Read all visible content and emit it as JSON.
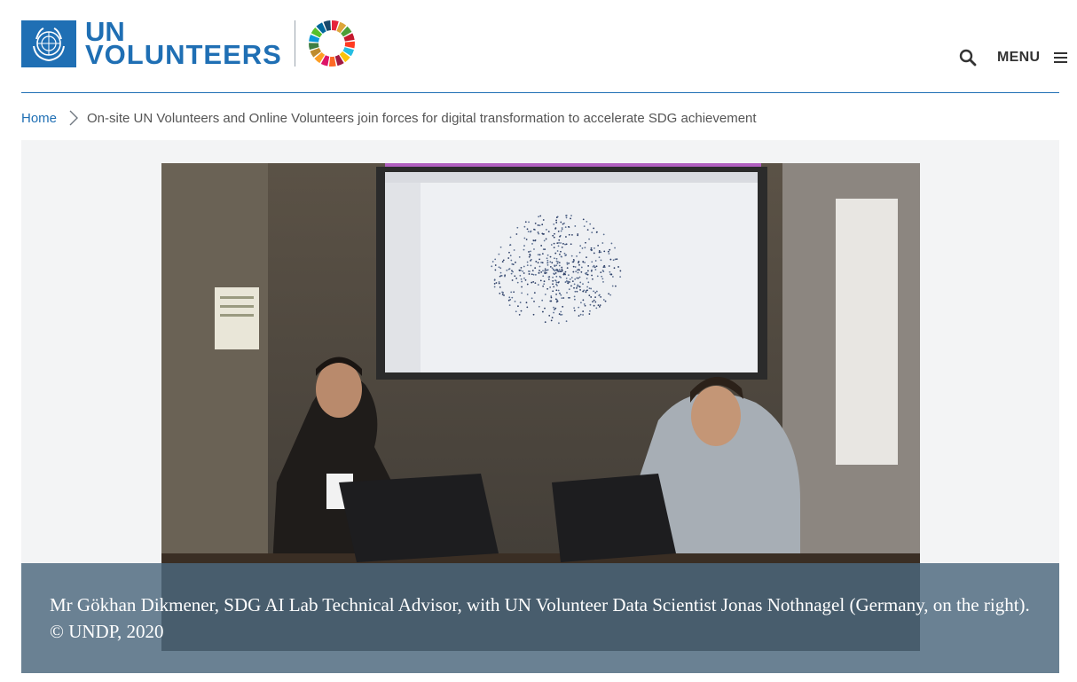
{
  "header": {
    "logo_line1": "UN",
    "logo_line2": "VOLUNTEERS",
    "menu_label": "MENU",
    "search_icon": "search-icon",
    "menu_icon": "hamburger-icon"
  },
  "colors": {
    "brand_blue": "#1f6fb4",
    "caption_overlay": "#4c687e"
  },
  "breadcrumb": {
    "home": "Home",
    "current": "On-site UN Volunteers and Online Volunteers join forces for digital transformation to accelerate SDG achievement"
  },
  "media": {
    "caption": "Mr Gökhan Dikmener, SDG AI Lab Technical Advisor, with UN Volunteer Data Scientist Jonas Nothnagel (Germany, on the right).  © UNDP, 2020"
  }
}
